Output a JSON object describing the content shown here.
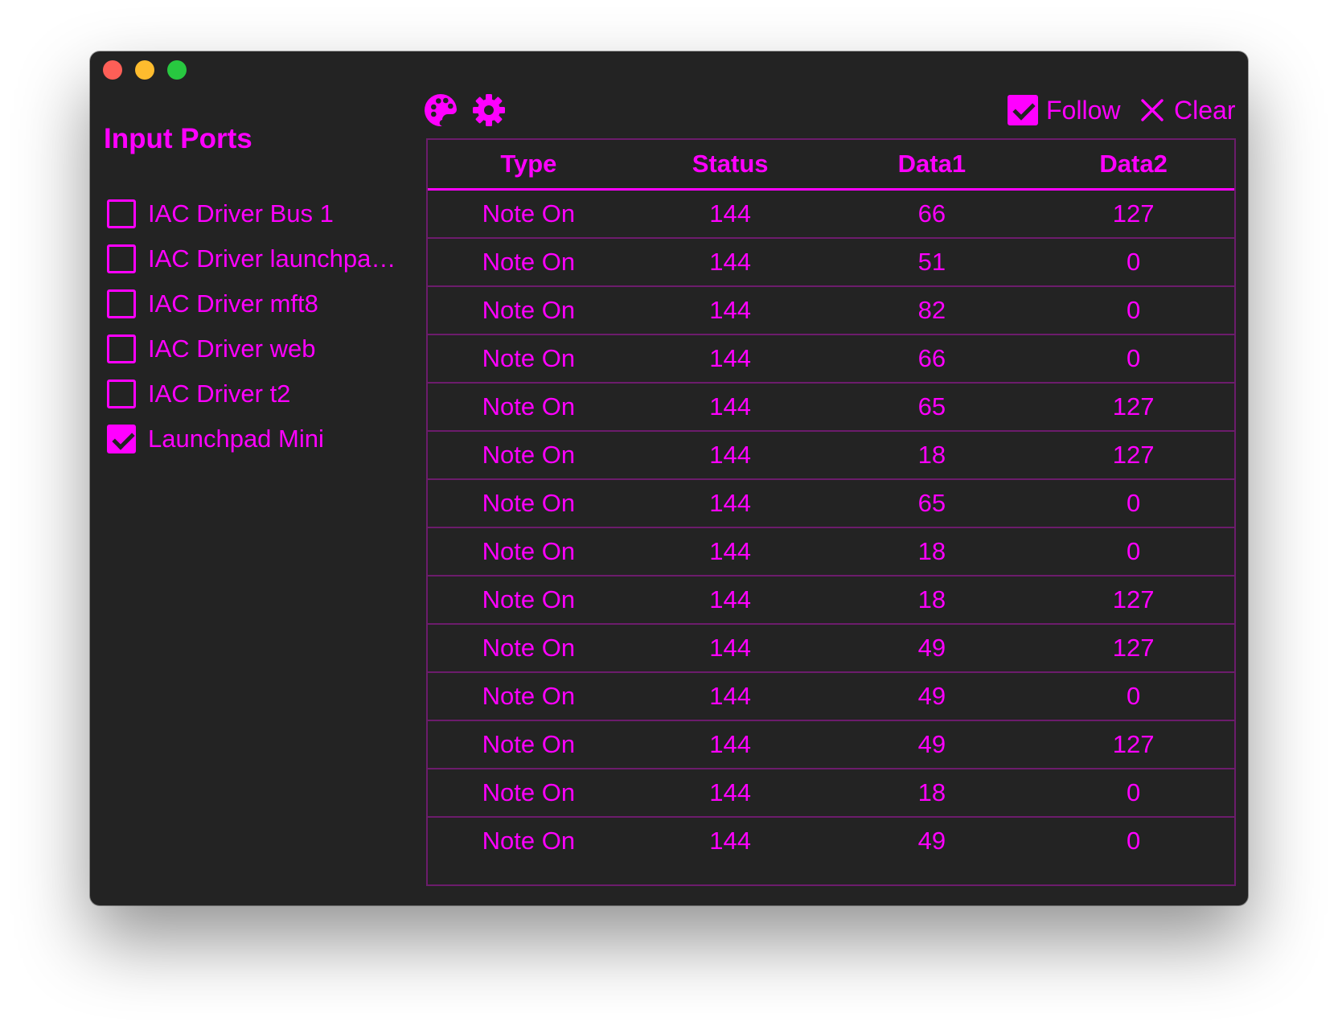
{
  "colors": {
    "accent": "#ff00ff",
    "window_background": "#232323",
    "grid_line": "#6c1c6c",
    "traffic_close": "#fe5f57",
    "traffic_minimize": "#febc2e",
    "traffic_maximize": "#28c840"
  },
  "sidebar": {
    "title": "Input Ports",
    "ports": [
      {
        "label": "IAC Driver Bus 1",
        "checked": false
      },
      {
        "label": "IAC Driver launchpadb…",
        "checked": false
      },
      {
        "label": "IAC Driver mft8",
        "checked": false
      },
      {
        "label": "IAC Driver web",
        "checked": false
      },
      {
        "label": "IAC Driver t2",
        "checked": false
      },
      {
        "label": "Launchpad Mini",
        "checked": true
      }
    ]
  },
  "toolbar": {
    "icons": [
      "palette-icon",
      "gear-icon"
    ],
    "follow": {
      "label": "Follow",
      "checked": true
    },
    "clear": {
      "label": "Clear",
      "icon": "close-icon"
    }
  },
  "table": {
    "columns": [
      "Type",
      "Status",
      "Data1",
      "Data2"
    ],
    "rows": [
      [
        "Note On",
        "144",
        "66",
        "127"
      ],
      [
        "Note On",
        "144",
        "51",
        "0"
      ],
      [
        "Note On",
        "144",
        "82",
        "0"
      ],
      [
        "Note On",
        "144",
        "66",
        "0"
      ],
      [
        "Note On",
        "144",
        "65",
        "127"
      ],
      [
        "Note On",
        "144",
        "18",
        "127"
      ],
      [
        "Note On",
        "144",
        "65",
        "0"
      ],
      [
        "Note On",
        "144",
        "18",
        "0"
      ],
      [
        "Note On",
        "144",
        "18",
        "127"
      ],
      [
        "Note On",
        "144",
        "49",
        "127"
      ],
      [
        "Note On",
        "144",
        "49",
        "0"
      ],
      [
        "Note On",
        "144",
        "49",
        "127"
      ],
      [
        "Note On",
        "144",
        "18",
        "0"
      ],
      [
        "Note On",
        "144",
        "49",
        "0"
      ]
    ]
  }
}
